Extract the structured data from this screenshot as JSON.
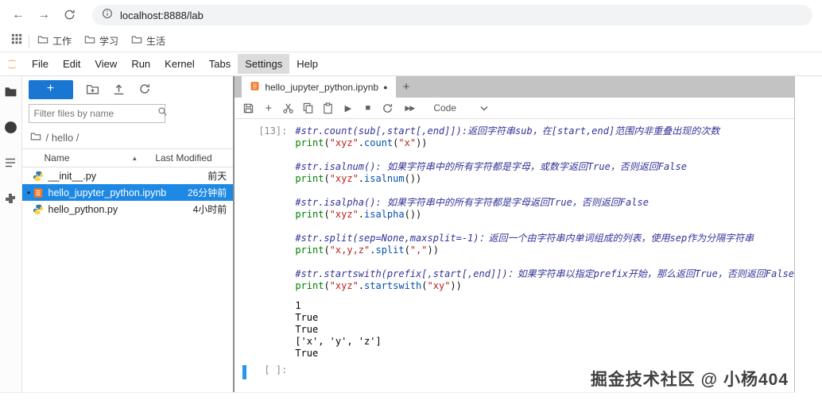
{
  "browser": {
    "url": "localhost:8888/lab",
    "bookmarks": [
      {
        "label": "工作"
      },
      {
        "label": "学习"
      },
      {
        "label": "生活"
      }
    ]
  },
  "icons": {
    "back": "←",
    "forward": "→",
    "plus": "+",
    "run": "▶",
    "stop": "■",
    "fast_forward": "▶▶",
    "sort_asc": "▲",
    "dirty_dot": "●",
    "running_dot": "●"
  },
  "colors": {
    "accent_blue": "#1e88e5",
    "new_button_blue": "#1976d2",
    "jupyter_orange": "#f37626",
    "active_cell_blue": "#2196f3",
    "code_comment": "#333399",
    "code_string": "#ba2121",
    "code_builtin": "#008000",
    "code_method": "#0550ae"
  },
  "menu": {
    "items": [
      "File",
      "Edit",
      "View",
      "Run",
      "Kernel",
      "Tabs",
      "Settings",
      "Help"
    ],
    "active": "Settings"
  },
  "filebrowser": {
    "filter_placeholder": "Filter files by name",
    "breadcrumb": "/ hello /",
    "columns": {
      "name": "Name",
      "modified": "Last Modified"
    },
    "files": [
      {
        "name": "__init__.py",
        "modified": "前天",
        "type": "python"
      },
      {
        "name": "hello_jupyter_python.ipynb",
        "modified": "26分钟前",
        "type": "notebook",
        "selected": true,
        "running": true
      },
      {
        "name": "hello_python.py",
        "modified": "4小时前",
        "type": "python"
      }
    ]
  },
  "tabbar": {
    "tabs": [
      {
        "label": "hello_jupyter_python.ipynb",
        "dirty": true
      }
    ]
  },
  "toolbar": {
    "cell_type_label": "Code"
  },
  "notebook": {
    "cells": [
      {
        "prompt": "[13]:",
        "lines": [
          [
            {
              "t": "c",
              "s": "#str.count(sub[,start[,end]]):返回字符串sub，在[start,end]范围内非重叠出现的次数"
            }
          ],
          [
            {
              "t": "b",
              "s": "print"
            },
            {
              "t": "p",
              "s": "("
            },
            {
              "t": "s",
              "s": "\"xyz\""
            },
            {
              "t": "p",
              "s": "."
            },
            {
              "t": "m",
              "s": "count"
            },
            {
              "t": "p",
              "s": "("
            },
            {
              "t": "s",
              "s": "\"x\""
            },
            {
              "t": "p",
              "s": "))"
            }
          ],
          [],
          [
            {
              "t": "c",
              "s": "#str.isalnum(): 如果字符串中的所有字符都是字母，或数字返回True，否则返回False"
            }
          ],
          [
            {
              "t": "b",
              "s": "print"
            },
            {
              "t": "p",
              "s": "("
            },
            {
              "t": "s",
              "s": "\"xyz\""
            },
            {
              "t": "p",
              "s": "."
            },
            {
              "t": "m",
              "s": "isalnum"
            },
            {
              "t": "p",
              "s": "())"
            }
          ],
          [],
          [
            {
              "t": "c",
              "s": "#str.isalpha(): 如果字符串中的所有字符都是字母返回True，否则返回False"
            }
          ],
          [
            {
              "t": "b",
              "s": "print"
            },
            {
              "t": "p",
              "s": "("
            },
            {
              "t": "s",
              "s": "\"xyz\""
            },
            {
              "t": "p",
              "s": "."
            },
            {
              "t": "m",
              "s": "isalpha"
            },
            {
              "t": "p",
              "s": "())"
            }
          ],
          [],
          [
            {
              "t": "c",
              "s": "#str.split(sep=None,maxsplit=-1)：返回一个由字符串内单词组成的列表，使用sep作为分隔字符串"
            }
          ],
          [
            {
              "t": "b",
              "s": "print"
            },
            {
              "t": "p",
              "s": "("
            },
            {
              "t": "s",
              "s": "\"x,y,z\""
            },
            {
              "t": "p",
              "s": "."
            },
            {
              "t": "m",
              "s": "split"
            },
            {
              "t": "p",
              "s": "("
            },
            {
              "t": "s",
              "s": "\",\""
            },
            {
              "t": "p",
              "s": "))"
            }
          ],
          [],
          [
            {
              "t": "c",
              "s": "#str.startswith(prefix[,start[,end]])：如果字符串以指定prefix开始，那么返回True，否则返回False"
            }
          ],
          [
            {
              "t": "b",
              "s": "print"
            },
            {
              "t": "p",
              "s": "("
            },
            {
              "t": "s",
              "s": "\"xyz\""
            },
            {
              "t": "p",
              "s": "."
            },
            {
              "t": "m",
              "s": "startswith"
            },
            {
              "t": "p",
              "s": "("
            },
            {
              "t": "s",
              "s": "\"xy\""
            },
            {
              "t": "p",
              "s": "))"
            }
          ]
        ],
        "outputs": [
          "1",
          "True",
          "True",
          "['x', 'y', 'z']",
          "True"
        ]
      },
      {
        "prompt": "[ ]:",
        "lines": [],
        "outputs": [],
        "active": true
      }
    ]
  },
  "watermark": {
    "text": "掘金技术社区 @ 小杨404"
  }
}
